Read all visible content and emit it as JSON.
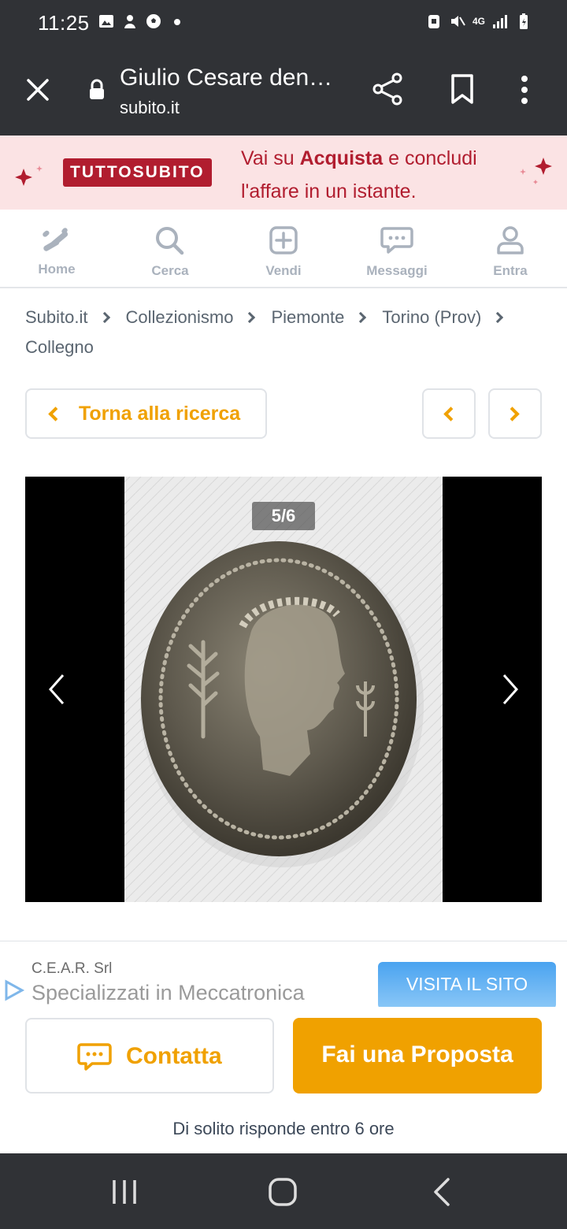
{
  "status_bar": {
    "time": "11:25",
    "network": "4G"
  },
  "browser": {
    "title": "Giulio Cesare den…",
    "url": "subito.it"
  },
  "promo": {
    "badge": "TUTTOSUBITO",
    "text_before": "Vai su ",
    "text_bold": "Acquista",
    "text_after": " e concludi l'affare in un istante."
  },
  "nav": {
    "items": [
      {
        "label": "Home",
        "icon": "home-logo-icon"
      },
      {
        "label": "Cerca",
        "icon": "search-icon"
      },
      {
        "label": "Vendi",
        "icon": "plus-square-icon"
      },
      {
        "label": "Messaggi",
        "icon": "chat-icon"
      },
      {
        "label": "Entra",
        "icon": "user-icon"
      }
    ]
  },
  "breadcrumb": [
    "Subito.it",
    "Collezionismo",
    "Piemonte",
    "Torino (Prov)",
    "Collegno"
  ],
  "back_button": {
    "label": "Torna alla ricerca"
  },
  "gallery": {
    "counter": "5/6"
  },
  "ad": {
    "advertiser": "C.E.A.R. Srl",
    "headline": "Specializzati in Meccatronica",
    "cta": "VISITA IL SITO"
  },
  "actions": {
    "contact": "Contatta",
    "offer": "Fai una Proposta",
    "reply_note": "Di solito risponde entro 6 ore"
  },
  "colors": {
    "accent": "#f0a100",
    "promo_red": "#b11d2f",
    "promo_bg": "#fbe3e4",
    "dark_bar": "#303236"
  }
}
